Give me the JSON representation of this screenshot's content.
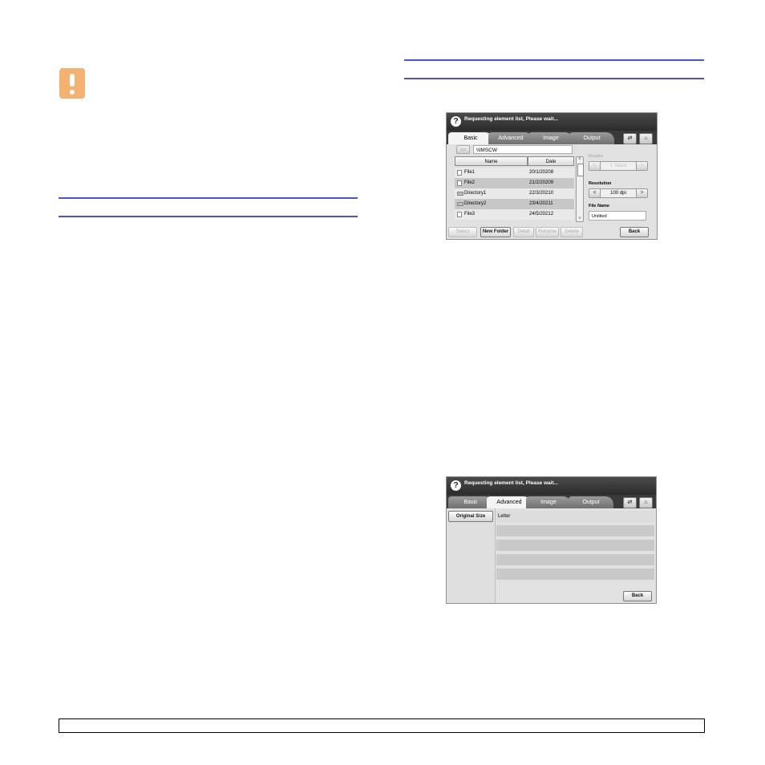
{
  "screen1": {
    "title": "Requesting element list, Please wait...",
    "tabs": [
      "Basic",
      "Advanced",
      "Image",
      "Output"
    ],
    "path": "\\\\IMSCW",
    "columns": {
      "name": "Name",
      "date": "Date"
    },
    "rows": [
      {
        "name": "File1",
        "date": "20/1/20208",
        "type": "file"
      },
      {
        "name": "File2",
        "date": "21/2/20209",
        "type": "file"
      },
      {
        "name": "Directory1",
        "date": "22/3/20210",
        "type": "folder"
      },
      {
        "name": "Directory2",
        "date": "23/4/20211",
        "type": "folder"
      },
      {
        "name": "File3",
        "date": "24/5/20212",
        "type": "file"
      }
    ],
    "duplex_label": "Duplex",
    "duplex_value": "1 Sided",
    "resolution_label": "Resolution",
    "resolution_value": "100 dpi",
    "filename_label": "File Name",
    "filename_value": "Untitled",
    "buttons": {
      "select": "Select",
      "new_folder": "New Folder",
      "detail": "Detail",
      "rename": "Rename",
      "delete": "Delete",
      "back": "Back"
    }
  },
  "screen2": {
    "title": "Requesting element list, Please wait...",
    "tabs": [
      "Basic",
      "Advanced",
      "Image",
      "Output"
    ],
    "original_size_button": "Original Size",
    "original_size_value": "Letter",
    "back_button": "Back"
  },
  "colors": {
    "rule": "#4b55c8",
    "caution_icon": "#f3b271"
  }
}
